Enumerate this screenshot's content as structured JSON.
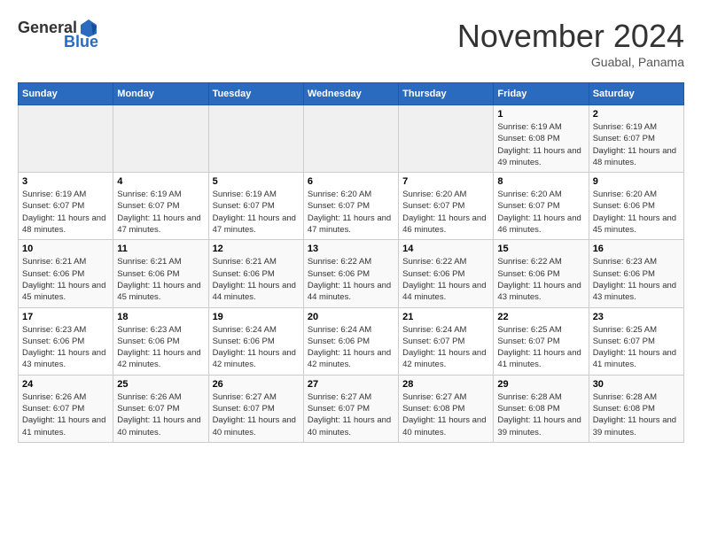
{
  "header": {
    "logo_general": "General",
    "logo_blue": "Blue",
    "title": "November 2024",
    "subtitle": "Guabal, Panama"
  },
  "calendar": {
    "days_of_week": [
      "Sunday",
      "Monday",
      "Tuesday",
      "Wednesday",
      "Thursday",
      "Friday",
      "Saturday"
    ],
    "weeks": [
      [
        {
          "day": "",
          "info": ""
        },
        {
          "day": "",
          "info": ""
        },
        {
          "day": "",
          "info": ""
        },
        {
          "day": "",
          "info": ""
        },
        {
          "day": "",
          "info": ""
        },
        {
          "day": "1",
          "info": "Sunrise: 6:19 AM\nSunset: 6:08 PM\nDaylight: 11 hours and 49 minutes."
        },
        {
          "day": "2",
          "info": "Sunrise: 6:19 AM\nSunset: 6:07 PM\nDaylight: 11 hours and 48 minutes."
        }
      ],
      [
        {
          "day": "3",
          "info": "Sunrise: 6:19 AM\nSunset: 6:07 PM\nDaylight: 11 hours and 48 minutes."
        },
        {
          "day": "4",
          "info": "Sunrise: 6:19 AM\nSunset: 6:07 PM\nDaylight: 11 hours and 47 minutes."
        },
        {
          "day": "5",
          "info": "Sunrise: 6:19 AM\nSunset: 6:07 PM\nDaylight: 11 hours and 47 minutes."
        },
        {
          "day": "6",
          "info": "Sunrise: 6:20 AM\nSunset: 6:07 PM\nDaylight: 11 hours and 47 minutes."
        },
        {
          "day": "7",
          "info": "Sunrise: 6:20 AM\nSunset: 6:07 PM\nDaylight: 11 hours and 46 minutes."
        },
        {
          "day": "8",
          "info": "Sunrise: 6:20 AM\nSunset: 6:07 PM\nDaylight: 11 hours and 46 minutes."
        },
        {
          "day": "9",
          "info": "Sunrise: 6:20 AM\nSunset: 6:06 PM\nDaylight: 11 hours and 45 minutes."
        }
      ],
      [
        {
          "day": "10",
          "info": "Sunrise: 6:21 AM\nSunset: 6:06 PM\nDaylight: 11 hours and 45 minutes."
        },
        {
          "day": "11",
          "info": "Sunrise: 6:21 AM\nSunset: 6:06 PM\nDaylight: 11 hours and 45 minutes."
        },
        {
          "day": "12",
          "info": "Sunrise: 6:21 AM\nSunset: 6:06 PM\nDaylight: 11 hours and 44 minutes."
        },
        {
          "day": "13",
          "info": "Sunrise: 6:22 AM\nSunset: 6:06 PM\nDaylight: 11 hours and 44 minutes."
        },
        {
          "day": "14",
          "info": "Sunrise: 6:22 AM\nSunset: 6:06 PM\nDaylight: 11 hours and 44 minutes."
        },
        {
          "day": "15",
          "info": "Sunrise: 6:22 AM\nSunset: 6:06 PM\nDaylight: 11 hours and 43 minutes."
        },
        {
          "day": "16",
          "info": "Sunrise: 6:23 AM\nSunset: 6:06 PM\nDaylight: 11 hours and 43 minutes."
        }
      ],
      [
        {
          "day": "17",
          "info": "Sunrise: 6:23 AM\nSunset: 6:06 PM\nDaylight: 11 hours and 43 minutes."
        },
        {
          "day": "18",
          "info": "Sunrise: 6:23 AM\nSunset: 6:06 PM\nDaylight: 11 hours and 42 minutes."
        },
        {
          "day": "19",
          "info": "Sunrise: 6:24 AM\nSunset: 6:06 PM\nDaylight: 11 hours and 42 minutes."
        },
        {
          "day": "20",
          "info": "Sunrise: 6:24 AM\nSunset: 6:06 PM\nDaylight: 11 hours and 42 minutes."
        },
        {
          "day": "21",
          "info": "Sunrise: 6:24 AM\nSunset: 6:07 PM\nDaylight: 11 hours and 42 minutes."
        },
        {
          "day": "22",
          "info": "Sunrise: 6:25 AM\nSunset: 6:07 PM\nDaylight: 11 hours and 41 minutes."
        },
        {
          "day": "23",
          "info": "Sunrise: 6:25 AM\nSunset: 6:07 PM\nDaylight: 11 hours and 41 minutes."
        }
      ],
      [
        {
          "day": "24",
          "info": "Sunrise: 6:26 AM\nSunset: 6:07 PM\nDaylight: 11 hours and 41 minutes."
        },
        {
          "day": "25",
          "info": "Sunrise: 6:26 AM\nSunset: 6:07 PM\nDaylight: 11 hours and 40 minutes."
        },
        {
          "day": "26",
          "info": "Sunrise: 6:27 AM\nSunset: 6:07 PM\nDaylight: 11 hours and 40 minutes."
        },
        {
          "day": "27",
          "info": "Sunrise: 6:27 AM\nSunset: 6:07 PM\nDaylight: 11 hours and 40 minutes."
        },
        {
          "day": "28",
          "info": "Sunrise: 6:27 AM\nSunset: 6:08 PM\nDaylight: 11 hours and 40 minutes."
        },
        {
          "day": "29",
          "info": "Sunrise: 6:28 AM\nSunset: 6:08 PM\nDaylight: 11 hours and 39 minutes."
        },
        {
          "day": "30",
          "info": "Sunrise: 6:28 AM\nSunset: 6:08 PM\nDaylight: 11 hours and 39 minutes."
        }
      ]
    ]
  }
}
